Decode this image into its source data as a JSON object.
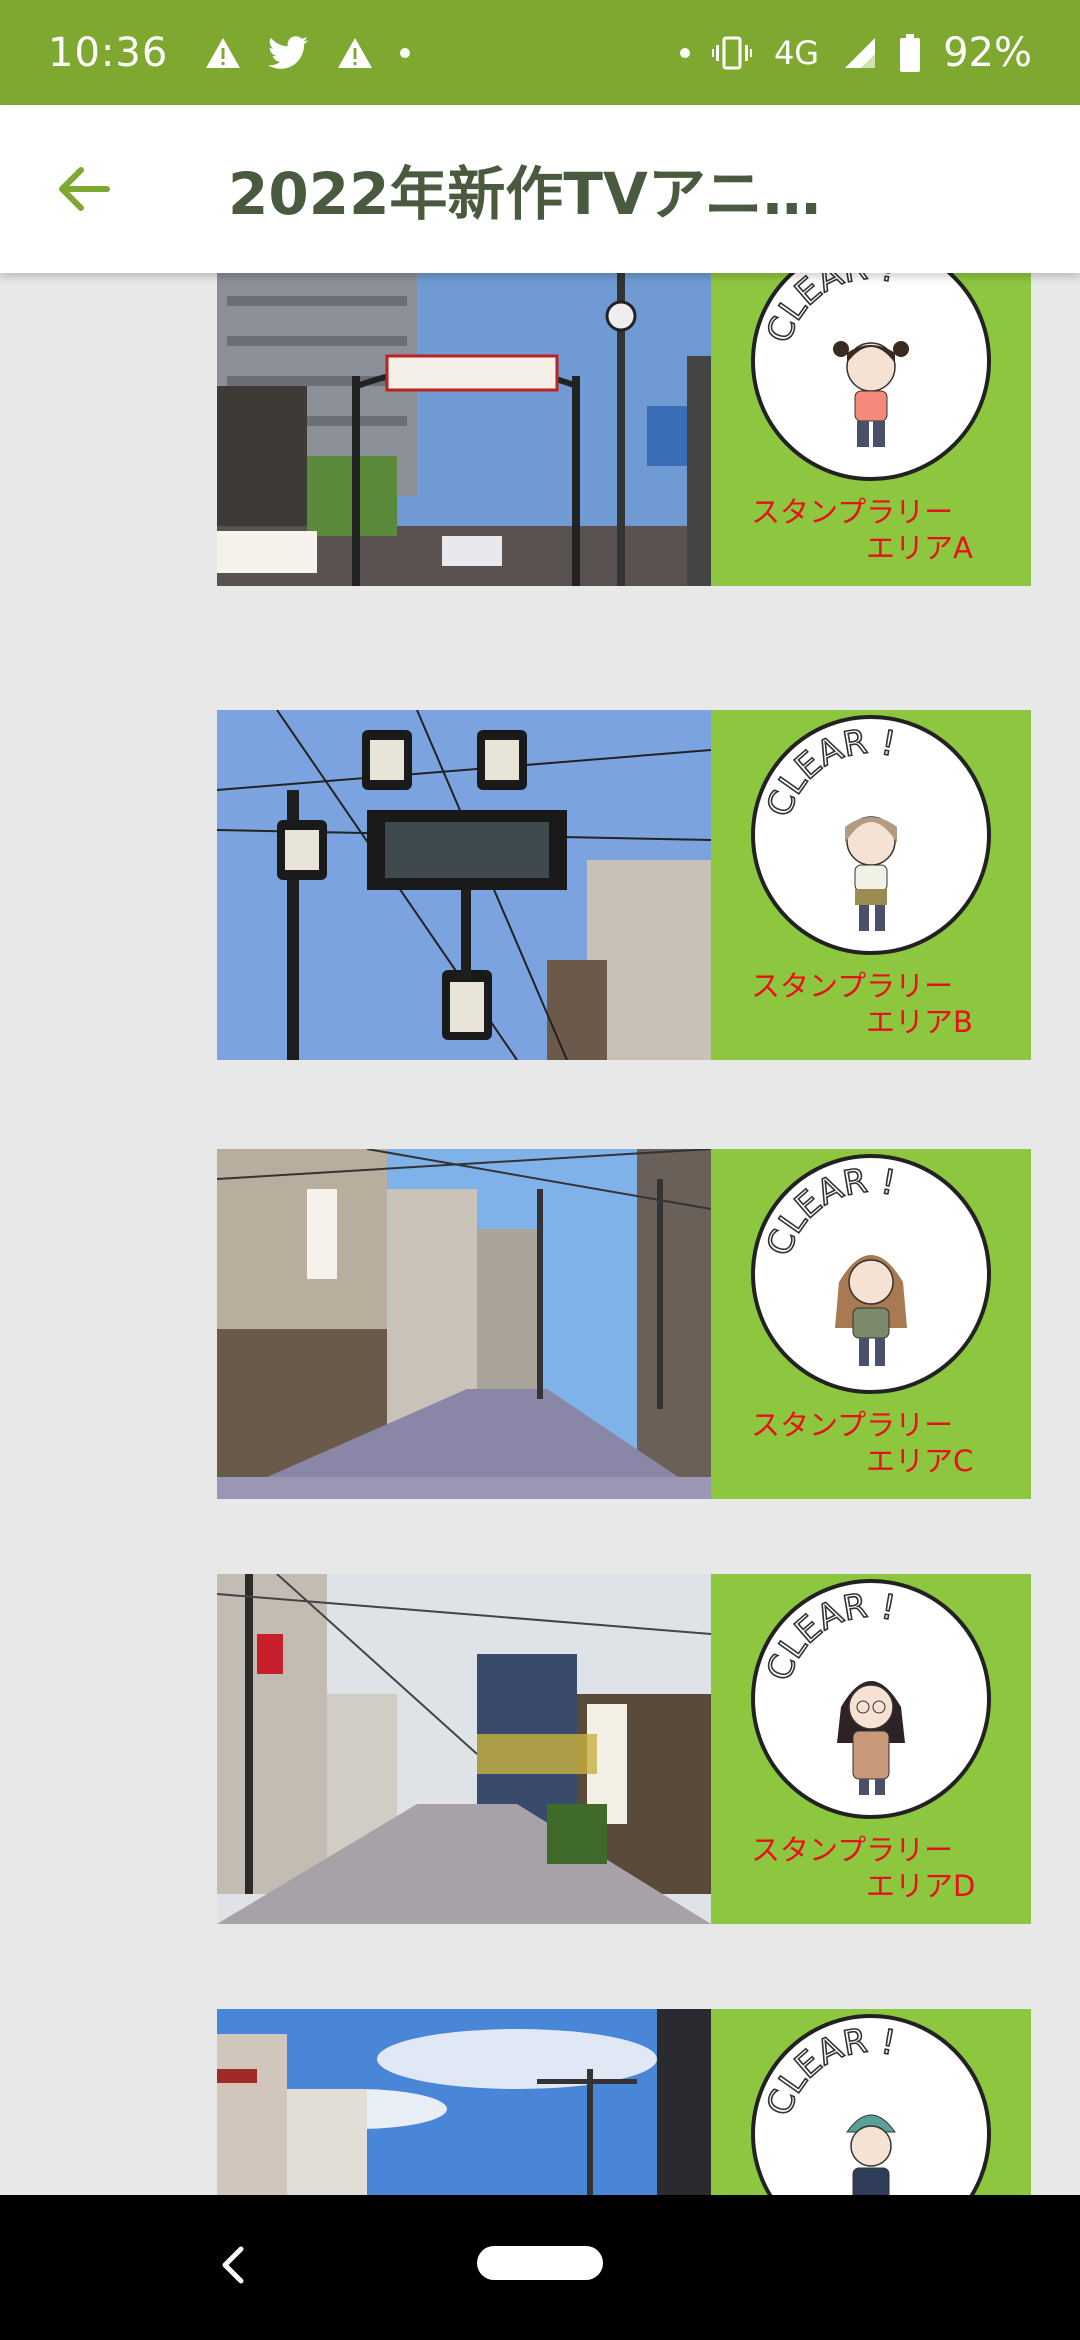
{
  "status_bar": {
    "time": "10:36",
    "network": "4G",
    "battery": "92%",
    "left_icons": [
      "alert-icon",
      "twitter-icon",
      "alert-icon",
      "dot-icon"
    ],
    "right_icons": [
      "dot-icon",
      "vibrate-icon",
      "signal-icon",
      "battery-icon"
    ]
  },
  "app_bar": {
    "title": "2022年新作TVアニ…",
    "back_icon": "arrow-back-icon"
  },
  "cards": [
    {
      "stamp_text": "CLEAR !",
      "label_line1": "スタンプラリー",
      "label_line2": "エリアA",
      "scene": "street-arch-sign"
    },
    {
      "stamp_text": "CLEAR !",
      "label_line1": "スタンプラリー",
      "label_line2": "エリアB",
      "scene": "street-lamp-sign"
    },
    {
      "stamp_text": "CLEAR !",
      "label_line1": "スタンプラリー",
      "label_line2": "エリアC",
      "scene": "shopping-street"
    },
    {
      "stamp_text": "CLEAR !",
      "label_line1": "スタンプラリー",
      "label_line2": "エリアD",
      "scene": "shopping-street-lanterns"
    },
    {
      "stamp_text": "CLEAR !",
      "label_line1": "",
      "label_line2": "",
      "scene": "sky-buildings"
    }
  ],
  "colors": {
    "accent": "#7ea830",
    "stamp_panel": "#8dc63f",
    "label_red": "#e8101a",
    "title_text": "#4a5a3f"
  },
  "nav_bar": {
    "back_icon": "nav-back-icon",
    "home_icon": "nav-home-pill"
  }
}
